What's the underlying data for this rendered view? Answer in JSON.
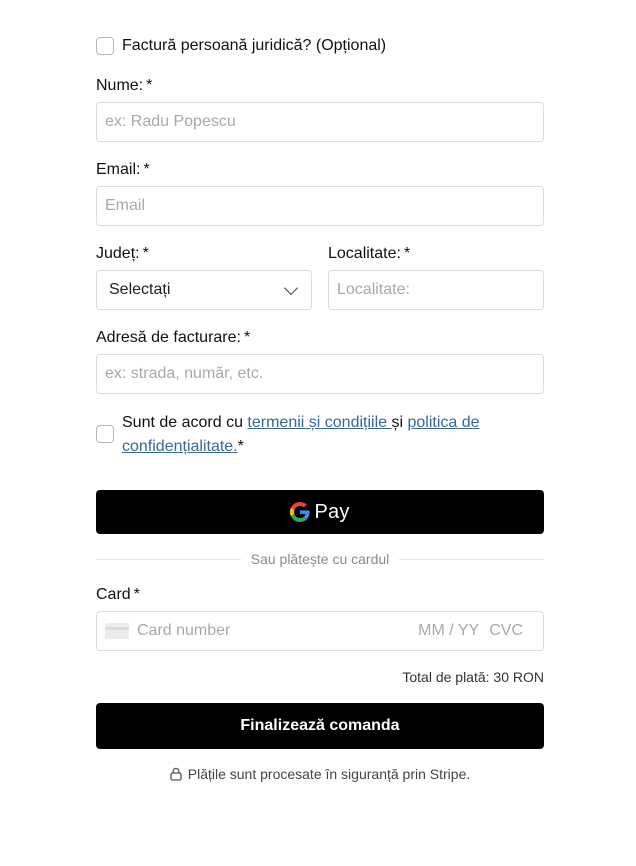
{
  "company_invoice": {
    "label": "Factură persoană juridică? (Opțional)"
  },
  "fields": {
    "name": {
      "label": "Nume:",
      "required": "*",
      "placeholder": "ex: Radu Popescu"
    },
    "email": {
      "label": "Email:",
      "required": "*",
      "placeholder": "Email"
    },
    "county": {
      "label": "Județ:",
      "required": "*",
      "selected": "Selectați"
    },
    "city": {
      "label": "Localitate:",
      "required": "*",
      "placeholder": "Localitate:"
    },
    "address": {
      "label": "Adresă de facturare:",
      "required": "*",
      "placeholder": "ex: strada, număr, etc."
    }
  },
  "terms": {
    "prefix": "Sunt de acord cu ",
    "terms_link": "termenii și condițiile ",
    "conj": "și ",
    "privacy_link": "politica de confidențialitate.",
    "required": "*"
  },
  "gpay": {
    "label": "Pay"
  },
  "divider": {
    "text": "Sau plătește cu cardul"
  },
  "card": {
    "label": "Card",
    "required": "*",
    "number_placeholder": "Card number",
    "expiry_placeholder": "MM / YY",
    "cvc_placeholder": "CVC"
  },
  "total": {
    "text": "Total de plată: 30 RON"
  },
  "submit": {
    "label": "Finalizează comanda"
  },
  "secure": {
    "text": "Plățile sunt procesate în siguranță prin Stripe."
  },
  "colors": {
    "link": "#36699a",
    "button": "#000000",
    "border": "#dcdcdc"
  }
}
